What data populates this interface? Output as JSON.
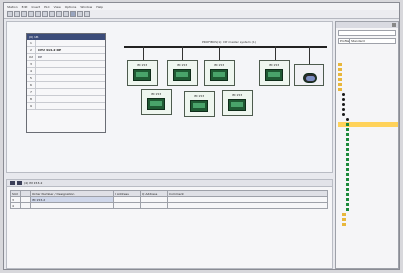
{
  "menubar": [
    "Station",
    "Edit",
    "Insert",
    "PLC",
    "View",
    "Options",
    "Window",
    "Help"
  ],
  "rack": {
    "title": "(0) UR",
    "rows": [
      {
        "slot": "1",
        "module": ""
      },
      {
        "slot": "2",
        "module": "CPU 414-2 DP"
      },
      {
        "slot": "X2",
        "module": "DP"
      },
      {
        "slot": "3",
        "module": ""
      },
      {
        "slot": "4",
        "module": ""
      },
      {
        "slot": "5",
        "module": ""
      },
      {
        "slot": "6",
        "module": ""
      },
      {
        "slot": "7",
        "module": ""
      },
      {
        "slot": "8",
        "module": ""
      },
      {
        "slot": "9",
        "module": ""
      }
    ]
  },
  "bus": {
    "label": "PROFIBUS(1): DP master system (1)"
  },
  "stations": [
    {
      "label": "IM 153"
    },
    {
      "label": "IM 153"
    },
    {
      "label": "IM 153"
    },
    {
      "label": "IM 153"
    },
    {
      "label": ""
    },
    {
      "label": "IM 153"
    },
    {
      "label": "IM 153"
    },
    {
      "label": "IM 153"
    }
  ],
  "detail": {
    "title": "(4) IM 153-2",
    "headers": [
      "Slot",
      "",
      "Order Number / Designation",
      "I Address",
      "Q Address",
      "Comment"
    ],
    "rows": [
      {
        "slot": "3",
        "icon": "",
        "name": "IM 153-2",
        "iaddr": "",
        "qaddr": "",
        "comment": ""
      },
      {
        "slot": "4",
        "icon": "",
        "name": "",
        "iaddr": "",
        "qaddr": "",
        "comment": ""
      }
    ]
  },
  "catalog": {
    "title": "",
    "profile_label": "Profile",
    "profile_value": "Standard",
    "tree": [
      {
        "label": "",
        "kind": "folder",
        "indent": 0
      },
      {
        "label": "",
        "kind": "folder",
        "indent": 0
      },
      {
        "label": "",
        "kind": "folder",
        "indent": 0
      },
      {
        "label": "",
        "kind": "folder",
        "indent": 0
      },
      {
        "label": "",
        "kind": "folder",
        "indent": 0
      },
      {
        "label": "",
        "kind": "folder",
        "indent": 0
      },
      {
        "label": "",
        "kind": "bullet",
        "indent": 1
      },
      {
        "label": "",
        "kind": "bullet",
        "indent": 1
      },
      {
        "label": "",
        "kind": "bullet",
        "indent": 1
      },
      {
        "label": "",
        "kind": "bullet",
        "indent": 1
      },
      {
        "label": "",
        "kind": "bullet",
        "indent": 1
      },
      {
        "label": "",
        "kind": "bullet",
        "indent": 2
      },
      {
        "label": "",
        "kind": "green",
        "indent": 2,
        "highlight": true
      },
      {
        "label": "",
        "kind": "green",
        "indent": 2
      },
      {
        "label": "",
        "kind": "green",
        "indent": 2
      },
      {
        "label": "",
        "kind": "green",
        "indent": 2
      },
      {
        "label": "",
        "kind": "green",
        "indent": 2
      },
      {
        "label": "",
        "kind": "green",
        "indent": 2
      },
      {
        "label": "",
        "kind": "green",
        "indent": 2
      },
      {
        "label": "",
        "kind": "green",
        "indent": 2
      },
      {
        "label": "",
        "kind": "green",
        "indent": 2
      },
      {
        "label": "",
        "kind": "green",
        "indent": 2
      },
      {
        "label": "",
        "kind": "green",
        "indent": 2
      },
      {
        "label": "",
        "kind": "green",
        "indent": 2
      },
      {
        "label": "",
        "kind": "green",
        "indent": 2
      },
      {
        "label": "",
        "kind": "green",
        "indent": 2
      },
      {
        "label": "",
        "kind": "green",
        "indent": 2
      },
      {
        "label": "",
        "kind": "green",
        "indent": 2
      },
      {
        "label": "",
        "kind": "green",
        "indent": 2
      },
      {
        "label": "",
        "kind": "green",
        "indent": 2
      },
      {
        "label": "",
        "kind": "folder",
        "indent": 1
      },
      {
        "label": "",
        "kind": "folder",
        "indent": 1
      },
      {
        "label": "",
        "kind": "folder",
        "indent": 1
      }
    ]
  },
  "icons": {
    "rack": "rack-icon",
    "station": "io-station-icon",
    "catalog_folder": "folder-icon"
  }
}
